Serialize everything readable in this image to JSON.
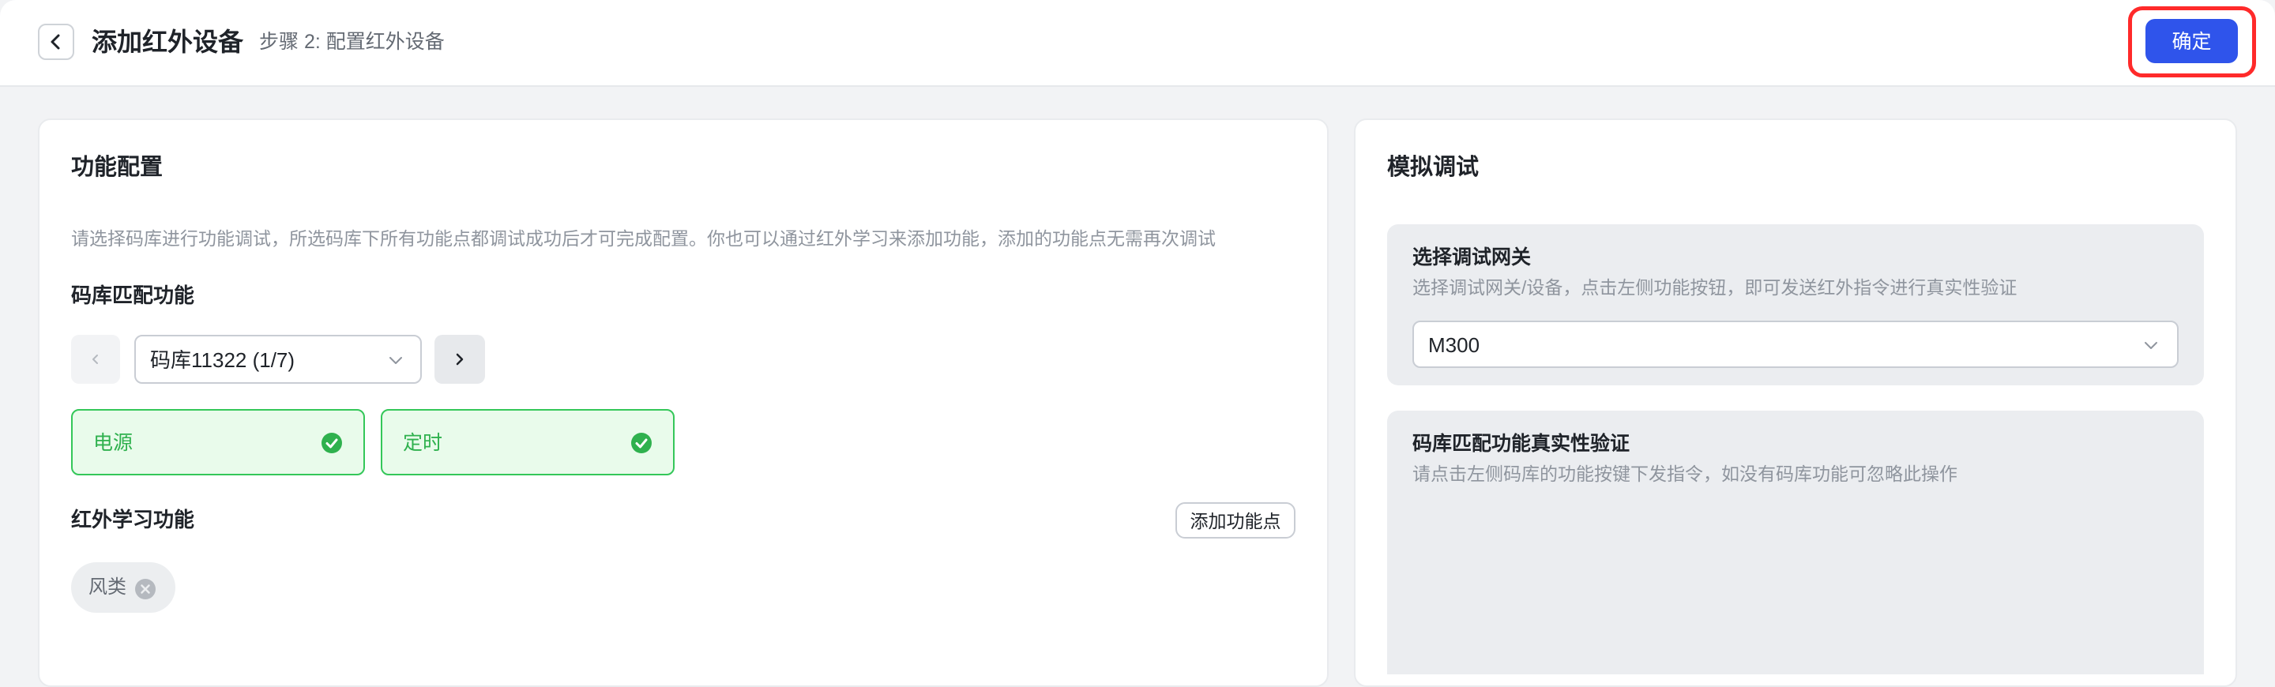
{
  "header": {
    "title": "添加红外设备",
    "step": "步骤 2: 配置红外设备",
    "confirm_label": "确定"
  },
  "left_card": {
    "title": "功能配置",
    "hint": "请选择码库进行功能调试，所选码库下所有功能点都调试成功后才可完成配置。你也可以通过红外学习来添加功能，添加的功能点无需再次调试",
    "library_section_title": "码库匹配功能",
    "library_selected": "码库11322 (1/7)",
    "functions": [
      {
        "label": "电源",
        "status": "success"
      },
      {
        "label": "定时",
        "status": "success"
      }
    ],
    "learning_section_title": "红外学习功能",
    "add_function_label": "添加功能点",
    "learned_tags": [
      {
        "label": "风类"
      }
    ]
  },
  "right_card": {
    "title": "模拟调试",
    "gateway_panel": {
      "title": "选择调试网关",
      "hint": "选择调试网关/设备，点击左侧功能按钮，即可发送红外指令进行真实性验证",
      "selected": "M300"
    },
    "verify_panel": {
      "title": "码库匹配功能真实性验证",
      "hint": "请点击左侧码库的功能按键下发指令，如没有码库功能可忽略此操作"
    }
  },
  "colors": {
    "primary": "#2f54eb",
    "success": "#34c759",
    "highlight_border": "#ff2a2a"
  }
}
